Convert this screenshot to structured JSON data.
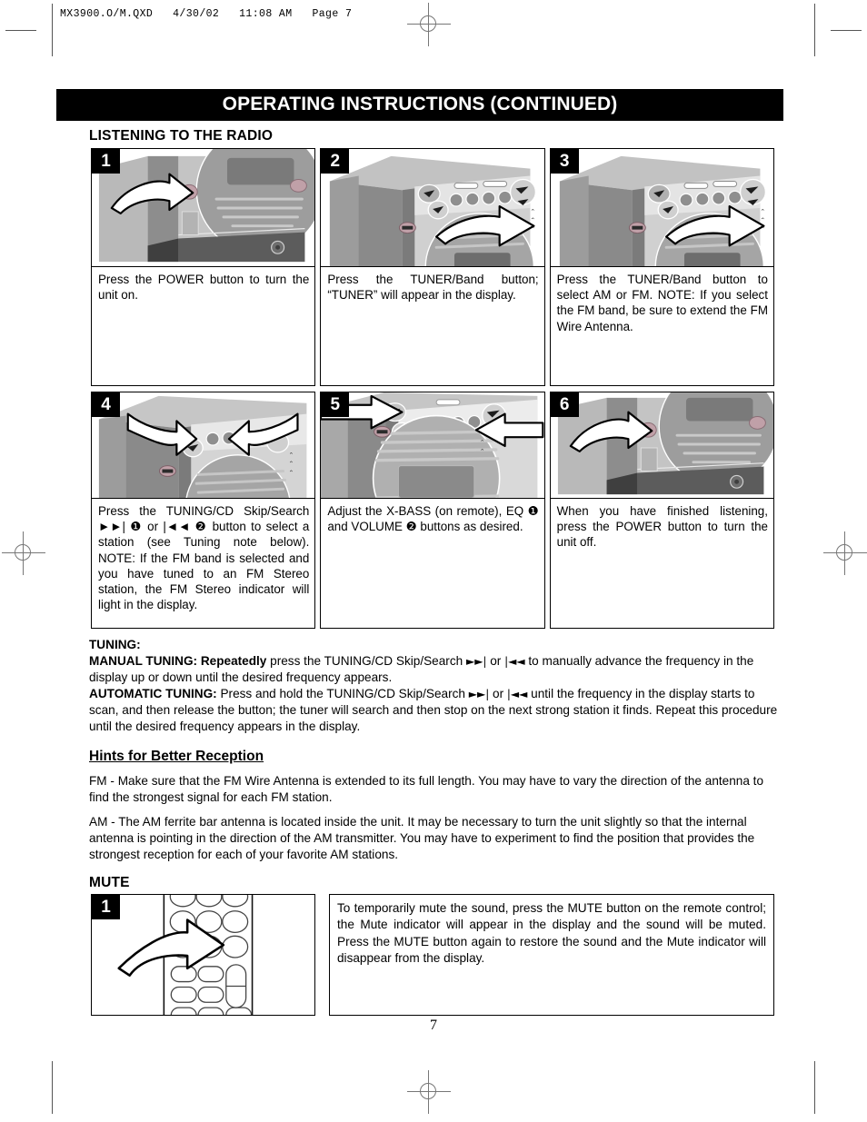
{
  "file_header": "MX3900.O/M.QXD   4/30/02   11:08 AM   Page 7",
  "title": "OPERATING INSTRUCTIONS (CONTINUED)",
  "section_heading": "LISTENING TO THE RADIO",
  "page_number": "7",
  "steps": [
    {
      "number": "1",
      "caption_html": "Press the POWER button to turn the unit on."
    },
    {
      "number": "2",
      "caption_html": "Press the TUNER/Band button; “TUNER” will appear in the display."
    },
    {
      "number": "3",
      "caption_html": "Press the TUNER/Band button to select AM or FM. NOTE: If you select the FM band, be sure to extend the FM Wire Antenna."
    },
    {
      "number": "4",
      "caption_html": "Press the TUNING/CD Skip/Search ►►| ❶ or |◄◄ ❷ button to select a station (see Tuning note below). NOTE: If the FM band is selected and you have tuned to an FM Stereo station, the FM Stereo indicator will light in the display."
    },
    {
      "number": "5",
      "caption_html": "Adjust the X-BASS (on remote), EQ ❶ and VOLUME ❷ buttons as desired."
    },
    {
      "number": "6",
      "caption_html": "When you have finished listening, press the POWER button to turn the unit off."
    }
  ],
  "tuning": {
    "heading": "TUNING:",
    "manual_label": "MANUAL TUNING: Repeatedly",
    "manual_text_a": " press the TUNING/CD Skip/Search ",
    "manual_sym1": "►►|",
    "manual_or": " or ",
    "manual_sym2": "|◄◄",
    "manual_text_b": " to manually advance the frequency in the display up or down until the desired frequency appears.",
    "auto_label": "AUTOMATIC TUNING:",
    "auto_text_a": " Press and hold the TUNING/CD Skip/Search ",
    "auto_sym1": "►►|",
    "auto_or": " or ",
    "auto_sym2": "|◄◄",
    "auto_text_b": " until the frequency in the display starts to scan, and then release the button; the tuner will search and then stop on the next strong station it finds. Repeat this procedure until the desired frequency appears in the display."
  },
  "hints": {
    "heading": "Hints for Better Reception",
    "fm": "FM - Make sure that the FM Wire Antenna is extended to its full length. You may have to vary the direction of the antenna to find the strongest signal for each FM station.",
    "am": "AM - The AM ferrite bar antenna is located inside the unit. It may be necessary to turn the unit slightly so that the internal antenna is pointing in the direction of the AM transmitter. You may have to experiment to find the position that provides the strongest reception for each of your favorite AM stations."
  },
  "mute": {
    "heading": "MUTE",
    "step_number": "1",
    "caption": "To temporarily mute the sound, press the MUTE button on the remote control; the Mute indicator will appear in the display and the sound will be muted. Press the MUTE button again to restore the sound and the Mute indicator will disappear from the display."
  },
  "colors": {
    "title_bar_bg": "#000000",
    "title_bar_text": "#ffffff",
    "page_bg": "#ffffff",
    "body_text": "#000000",
    "photo_light_gray": "#d3d3d3",
    "photo_mid_gray": "#a8a8a8",
    "photo_dark_gray": "#6e6e6e",
    "photo_darkest": "#4a4a4a",
    "arrow_fill": "#ffffff",
    "knob_accent": "#c9a2ae"
  }
}
